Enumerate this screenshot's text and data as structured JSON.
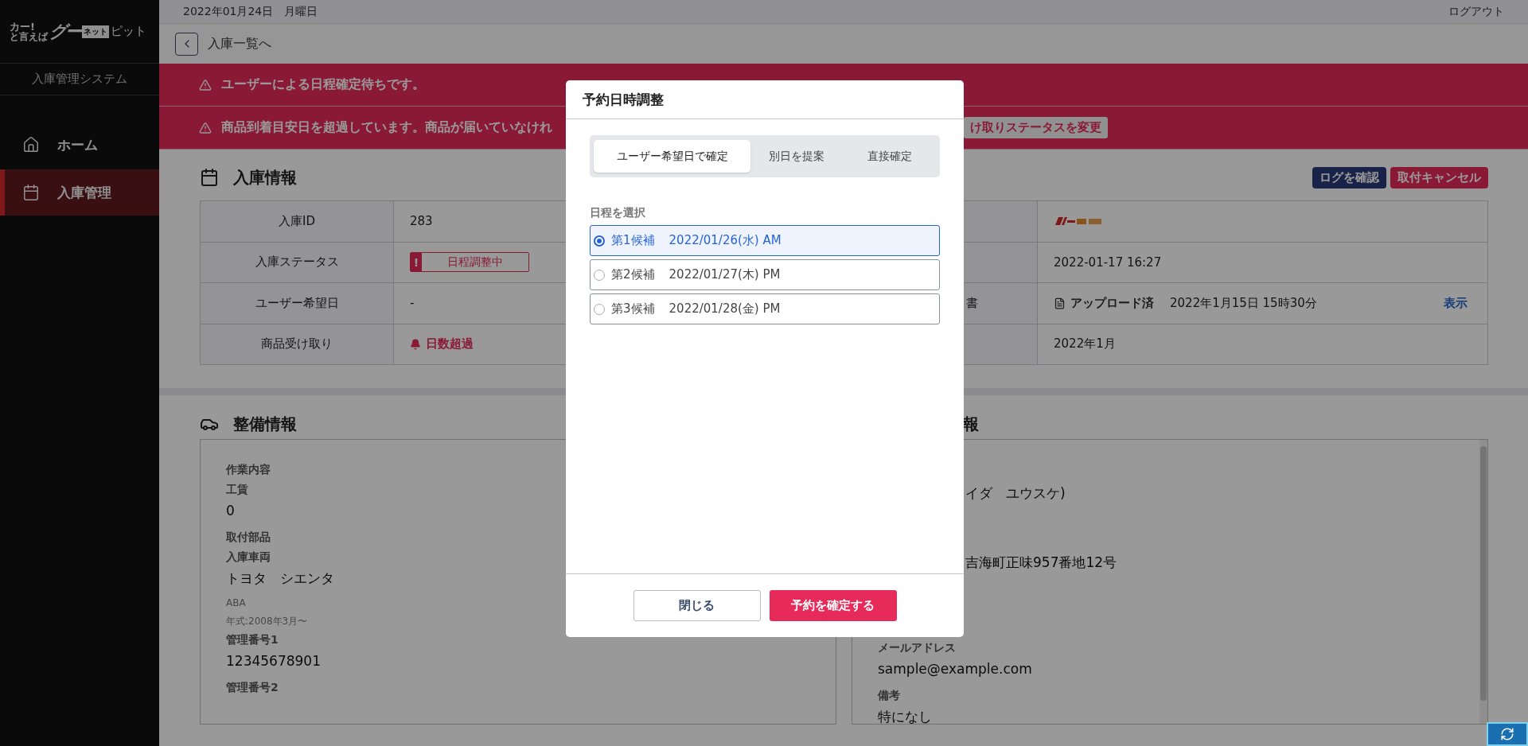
{
  "sidebar": {
    "logo": {
      "top": "カー!",
      "bottom": "と言えば",
      "brand": "グー",
      "badge": "ネット",
      "suffix": "ピット"
    },
    "subtitle": "入庫管理システム",
    "items": [
      {
        "label": "ホーム",
        "selected": false
      },
      {
        "label": "入庫管理",
        "selected": true
      }
    ]
  },
  "header": {
    "date": "2022年01月24日　月曜日",
    "logout": "ログアウト"
  },
  "back_link": {
    "label": "入庫一覧へ"
  },
  "alerts": [
    {
      "text": "ユーザーによる日程確定待ちです。"
    },
    {
      "text": "商品到着目安日を超過しています。商品が届いていなけれ",
      "action": "け取りステータスを変更"
    }
  ],
  "entry_section": {
    "title": "入庫情報",
    "buttons": [
      {
        "label": "ログを確認",
        "kind": "secondary"
      },
      {
        "label": "取付キャンセル",
        "kind": "danger"
      }
    ],
    "rows": [
      {
        "label": "入庫ID",
        "value": {
          "kind": "text",
          "text": "283"
        },
        "value_2": {
          "kind": "logo"
        }
      },
      {
        "label": "入庫ステータス",
        "value": {
          "kind": "badge",
          "mark": "!",
          "text": "日程調整中"
        },
        "value_2": {
          "kind": "text",
          "text": "2022-01-17 16:27"
        }
      },
      {
        "label": "ユーザー希望日",
        "value": {
          "kind": "text",
          "text": "-"
        },
        "label_2": "書",
        "value_2": {
          "kind": "document",
          "status": "アップロード済",
          "text": "2022年1月15日 15時30分",
          "link": "表示"
        }
      },
      {
        "label": "商品受け取り",
        "value": {
          "kind": "alert",
          "text": "日数超過"
        },
        "value_2": {
          "kind": "text",
          "text": "2022年1月"
        }
      }
    ]
  },
  "service_section": {
    "title": "整備情報",
    "fields": [
      {
        "kind": "label",
        "text": "作業内容"
      },
      {
        "kind": "label",
        "text": "工賃"
      },
      {
        "kind": "value",
        "text": "0"
      },
      {
        "kind": "label",
        "text": "取付部品"
      },
      {
        "kind": "label",
        "text": "入庫車両"
      },
      {
        "kind": "value",
        "text": "トヨタ　シエンタ"
      },
      {
        "kind": "note",
        "text": "ABA"
      },
      {
        "kind": "note",
        "text": "年式:2008年3月〜"
      },
      {
        "kind": "label",
        "text": "管理番号1"
      },
      {
        "kind": "value",
        "text": "12345678901"
      },
      {
        "kind": "label",
        "text": "管理番号2"
      }
    ]
  },
  "customer_section": {
    "title": "報",
    "fields": [
      {
        "kind": "peek",
        "text": "イダ　ユウスケ)"
      },
      {
        "kind": "peek",
        "text": "吉海町正味957番地12号"
      },
      {
        "kind": "label",
        "text": "メールアドレス"
      },
      {
        "kind": "value",
        "text": "sample@example.com"
      },
      {
        "kind": "label",
        "text": "備考"
      },
      {
        "kind": "value",
        "text": "特になし"
      }
    ]
  },
  "modal": {
    "title": "予約日時調整",
    "tabs": [
      {
        "label": "ユーザー希望日で確定",
        "selected": true
      },
      {
        "label": "別日を提案",
        "selected": false
      },
      {
        "label": "直接確定",
        "selected": false
      }
    ],
    "field_label": "日程を選択",
    "options": [
      {
        "number": "第1候補",
        "date": "2022/01/26(水) AM",
        "selected": true
      },
      {
        "number": "第2候補",
        "date": "2022/01/27(木) PM",
        "selected": false
      },
      {
        "number": "第3候補",
        "date": "2022/01/28(金) PM",
        "selected": false
      }
    ],
    "buttons": [
      {
        "label": "閉じる",
        "kind": "secondary"
      },
      {
        "label": "予約を確定する",
        "kind": "primary"
      }
    ]
  }
}
